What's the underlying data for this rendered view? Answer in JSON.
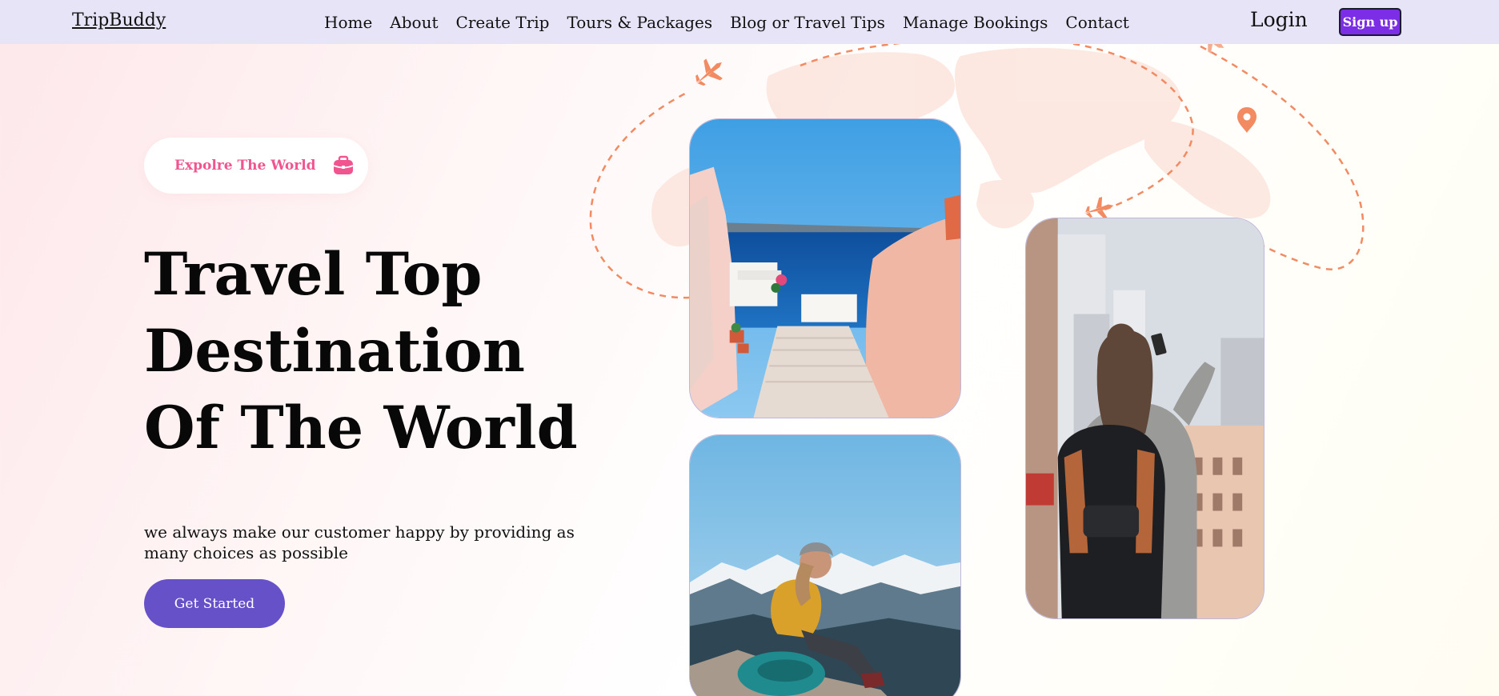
{
  "nav": {
    "brand": "TripBuddy",
    "links": [
      "Home",
      "About",
      "Create Trip",
      "Tours & Packages",
      "Blog or Travel Tips",
      "Manage Bookings",
      "Contact"
    ],
    "login": "Login",
    "signup": "Sign up"
  },
  "hero": {
    "pill_text": "Expolre The World",
    "title_lines": [
      "Travel Top",
      "Destination",
      "Of The World"
    ],
    "subtitle": "we always make our customer happy by providing as many choices as possible",
    "cta": "Get Started"
  },
  "colors": {
    "nav_bg": "#e8e4f7",
    "signup_bg": "#7b2ee6",
    "accent_pink": "#f0558f",
    "cta_bg": "#6751c9",
    "route_orange": "#f28a62"
  },
  "icons": {
    "pill_icon": "briefcase-icon",
    "decor": [
      "airplane-icon",
      "airplane-icon",
      "airplane-icon",
      "location-pin-icon",
      "world-map"
    ]
  }
}
